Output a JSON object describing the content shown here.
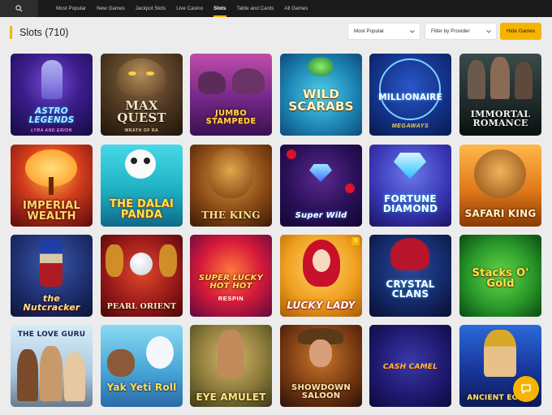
{
  "nav": {
    "items": [
      {
        "label": "Most Popular",
        "active": false
      },
      {
        "label": "New Games",
        "active": false
      },
      {
        "label": "Jackpot Slots",
        "active": false
      },
      {
        "label": "Live Casino",
        "active": false
      },
      {
        "label": "Slots",
        "active": true
      },
      {
        "label": "Table and Cards",
        "active": false
      },
      {
        "label": "All Games",
        "active": false
      }
    ]
  },
  "header": {
    "title": "Slots (710)",
    "sort_value": "Most Popular",
    "provider_value": "Filter by Provider",
    "hide_games_label": "Hide Games"
  },
  "colors": {
    "accent": "#f6b400",
    "nav_bg": "#1a1a1a",
    "page_bg": "#ececec"
  },
  "games": [
    {
      "title": "ASTRO LEGENDS",
      "subtitle": "LYRA AND ERION"
    },
    {
      "title": "MAX QUEST",
      "subtitle": "WRATH OF RA"
    },
    {
      "title": "JUMBO STAMPEDE",
      "subtitle": ""
    },
    {
      "title": "WILD SCARABS",
      "subtitle": ""
    },
    {
      "title": "MILLIONAIRE",
      "subtitle": "MEGAWAYS"
    },
    {
      "title": "IMMORTAL ROMANCE",
      "subtitle": ""
    },
    {
      "title": "IMPERIAL WEALTH",
      "subtitle": ""
    },
    {
      "title": "THE DALAI PANDA",
      "subtitle": ""
    },
    {
      "title": "THE KING",
      "subtitle": ""
    },
    {
      "title": "Super Wild",
      "subtitle": ""
    },
    {
      "title": "FORTUNE DIAMOND",
      "subtitle": ""
    },
    {
      "title": "SAFARI KING",
      "subtitle": ""
    },
    {
      "title": "the Nutcracker",
      "subtitle": ""
    },
    {
      "title": "PEARL ORIENT",
      "subtitle": ""
    },
    {
      "title": "SUPER LUCKY HOT HOT",
      "subtitle": "RESPIN"
    },
    {
      "title": "LUCKY LADY",
      "subtitle": ""
    },
    {
      "title": "CRYSTAL CLANS",
      "subtitle": ""
    },
    {
      "title": "Stacks O' Gold",
      "subtitle": ""
    },
    {
      "title": "THE LOVE GURU",
      "subtitle": ""
    },
    {
      "title": "Yak Yeti Roll",
      "subtitle": ""
    },
    {
      "title": "EYE AMULET",
      "subtitle": ""
    },
    {
      "title": "SHOWDOWN SALOON",
      "subtitle": ""
    },
    {
      "title": "CASH CAMEL",
      "subtitle": ""
    },
    {
      "title": "ANCIENT EGYPT",
      "subtitle": ""
    }
  ]
}
